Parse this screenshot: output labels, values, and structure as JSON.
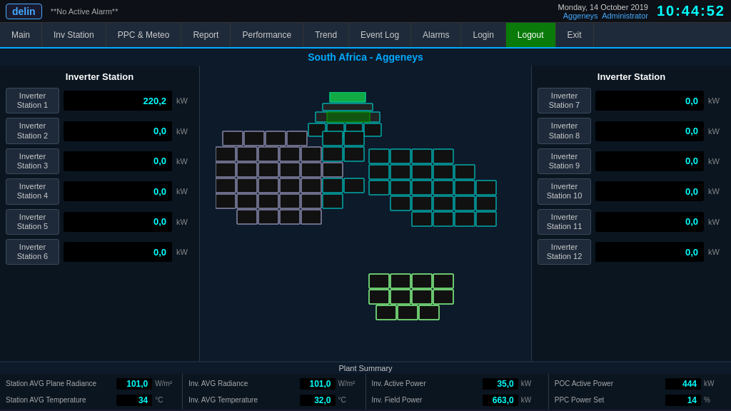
{
  "topbar": {
    "logo": "delin",
    "alarm": "**No Active Alarm**",
    "date": "Monday, 14 October 2019",
    "location": "Aggeneys",
    "user": "Administrator",
    "clock": "10:44:52"
  },
  "nav": {
    "items": [
      {
        "id": "main",
        "label": "Main",
        "active": false
      },
      {
        "id": "inv-station",
        "label": "Inv Station",
        "active": false
      },
      {
        "id": "ppc-meteo",
        "label": "PPC & Meteo",
        "active": false
      },
      {
        "id": "report",
        "label": "Report",
        "active": false
      },
      {
        "id": "performance",
        "label": "Performance",
        "active": false
      },
      {
        "id": "trend",
        "label": "Trend",
        "active": false
      },
      {
        "id": "event-log",
        "label": "Event Log",
        "active": false
      },
      {
        "id": "alarms",
        "label": "Alarms",
        "active": false
      },
      {
        "id": "login",
        "label": "Login",
        "active": false
      },
      {
        "id": "logout",
        "label": "Logout",
        "active": true
      },
      {
        "id": "exit",
        "label": "Exit",
        "active": false
      }
    ]
  },
  "title": "South Africa - Aggeneys",
  "left_panel": {
    "title": "Inverter Station",
    "stations": [
      {
        "label": "Inverter Station 1",
        "value": "220,2",
        "unit": "kW"
      },
      {
        "label": "Inverter Station 2",
        "value": "0,0",
        "unit": "kW"
      },
      {
        "label": "Inverter Station 3",
        "value": "0,0",
        "unit": "kW"
      },
      {
        "label": "Inverter Station 4",
        "value": "0,0",
        "unit": "kW"
      },
      {
        "label": "Inverter Station 5",
        "value": "0,0",
        "unit": "kW"
      },
      {
        "label": "Inverter Station 6",
        "value": "0,0",
        "unit": "kW"
      }
    ]
  },
  "right_panel": {
    "title": "Inverter Station",
    "stations": [
      {
        "label": "Inverter Station 7",
        "value": "0,0",
        "unit": "kW"
      },
      {
        "label": "Inverter Station 8",
        "value": "0,0",
        "unit": "kW"
      },
      {
        "label": "Inverter Station 9",
        "value": "0,0",
        "unit": "kW"
      },
      {
        "label": "Inverter Station 10",
        "value": "0,0",
        "unit": "kW"
      },
      {
        "label": "Inverter Station 11",
        "value": "0,0",
        "unit": "kW"
      },
      {
        "label": "Inverter Station 12",
        "value": "0,0",
        "unit": "kW"
      }
    ]
  },
  "summary": {
    "title": "Plant Summary",
    "col1": [
      {
        "label": "Station AVG Plane Radiance",
        "value": "101,0",
        "unit": "W/m²"
      },
      {
        "label": "Station AVG Temperature",
        "value": "34",
        "unit": "°C"
      }
    ],
    "col2": [
      {
        "label": "Inv. AVG Radiance",
        "value": "101,0",
        "unit": "W/m²"
      },
      {
        "label": "Inv. AVG Temperature",
        "value": "32,0",
        "unit": "°C"
      }
    ],
    "col3": [
      {
        "label": "Inv. Active Power",
        "value": "35,0",
        "unit": "kW"
      },
      {
        "label": "Inv. Field Power",
        "value": "663,0",
        "unit": "kW"
      }
    ],
    "col4": [
      {
        "label": "POC Active Power",
        "value": "444",
        "unit": "kW"
      },
      {
        "label": "PPC Power Set",
        "value": "14",
        "unit": "%"
      }
    ]
  }
}
